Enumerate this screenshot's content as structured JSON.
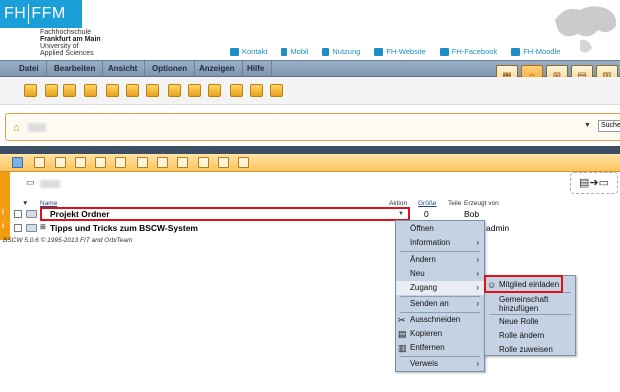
{
  "brand": {
    "short1": "FH",
    "short2": "FFM",
    "line1": "Fachhochschule",
    "line2": "Frankfurt am Main",
    "line3": "University of",
    "line4": "Applied Sciences"
  },
  "toplinks": [
    {
      "label": "Kontakt",
      "icon": "mail-icon"
    },
    {
      "label": "Mobil",
      "icon": "phone-icon"
    },
    {
      "label": "Nutzung",
      "icon": "document-icon"
    },
    {
      "label": "FH-Website",
      "icon": "home-icon"
    },
    {
      "label": "FH-Facebook",
      "icon": "facebook-icon"
    },
    {
      "label": "FH-Moodle",
      "icon": "moodle-icon"
    }
  ],
  "menu": [
    "Datei",
    "Bearbeiten",
    "Ansicht",
    "Optionen",
    "Anzeigen",
    "Hilfe"
  ],
  "search": {
    "label": "Suchen"
  },
  "columns": {
    "name": "Name",
    "action": "Aktion",
    "size": "Größe",
    "share": "Teile",
    "created_by": "Erzeugt von"
  },
  "rows": [
    {
      "name": "Projekt Ordner",
      "size": "0",
      "created_by": "Bob",
      "info": "i"
    },
    {
      "name": "Tipps und Tricks zum BSCW-System",
      "created_by": "admin",
      "info": "i"
    }
  ],
  "footer": "BSCW 5.0.6 © 1995-2013 FIT and OrbiTeam",
  "context_menu": [
    {
      "label": "Öffnen"
    },
    {
      "label": "Information",
      "sub": true
    },
    {
      "label": "Ändern",
      "sub": true
    },
    {
      "label": "Neu",
      "sub": true
    },
    {
      "label": "Zugang",
      "sub": true
    },
    {
      "label": "Senden an",
      "sub": true
    },
    {
      "label": "Ausschneiden",
      "icon": "scissors-icon"
    },
    {
      "label": "Kopieren",
      "icon": "copy-icon"
    },
    {
      "label": "Entfernen",
      "icon": "trash-icon"
    },
    {
      "label": "Verweis",
      "sub": true
    }
  ],
  "submenu": [
    {
      "label": "Mitglied einladen",
      "icon": "invite-member-icon"
    },
    {
      "label": "Gemeinschaft hinzufügen"
    },
    {
      "label": "Neue Rolle"
    },
    {
      "label": "Rolle ändern"
    },
    {
      "label": "Rolle zuweisen"
    }
  ],
  "colors": {
    "accent": "#f39c12",
    "highlight": "#e0111b",
    "brand": "#1a9fd8"
  }
}
